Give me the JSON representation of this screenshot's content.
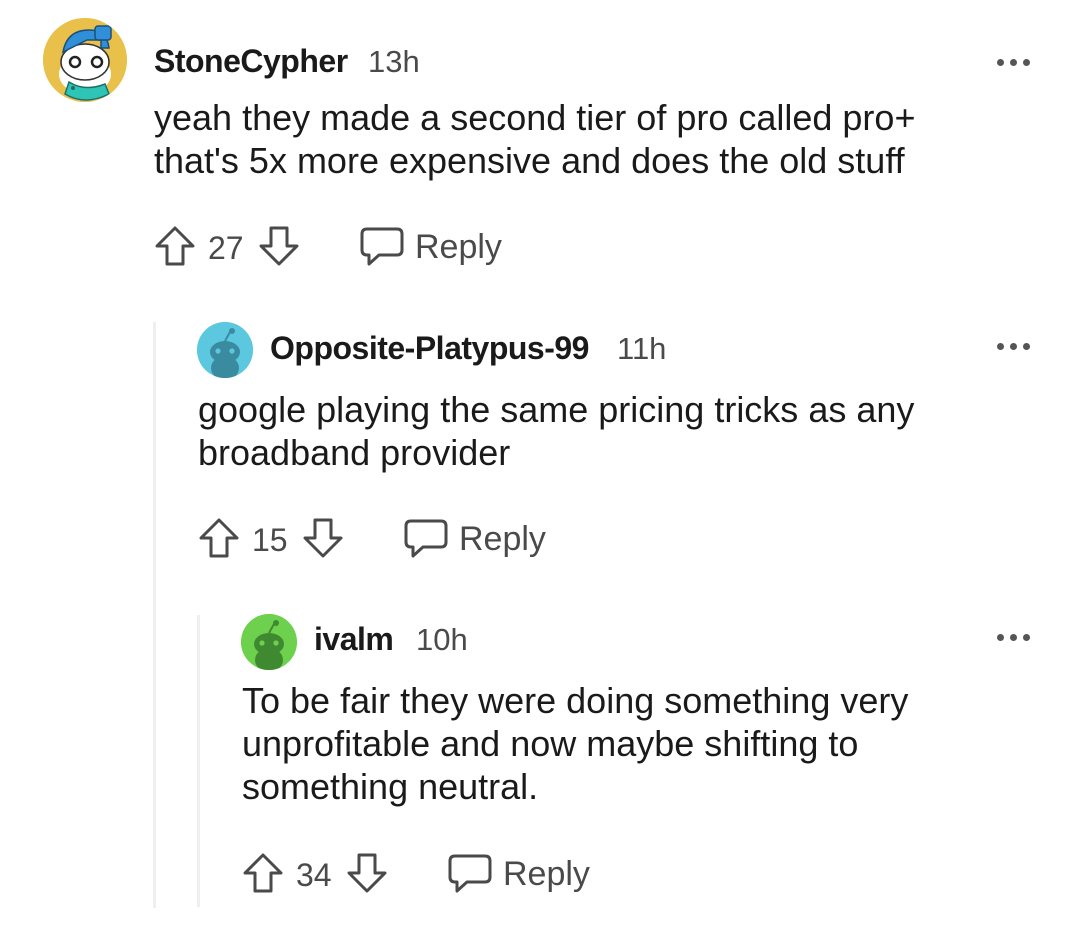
{
  "comments": [
    {
      "username": "StoneCypher",
      "timestamp": "13h",
      "body_lines": [
        "yeah they made a second tier of pro called pro+",
        "that's 5x more expensive and does the old stuff"
      ],
      "votes": "27",
      "reply_label": "Reply",
      "avatar_icon": "snoo-avatar-blue-cap-icon"
    },
    {
      "username": "Opposite-Platypus-99",
      "timestamp": "11h",
      "body_lines": [
        "google playing the same pricing tricks as any",
        "broadband provider"
      ],
      "votes": "15",
      "reply_label": "Reply",
      "avatar_icon": "default-snoo-avatar-cyan-icon"
    },
    {
      "username": "ivalm",
      "timestamp": "10h",
      "body_lines": [
        "To be fair they were doing something very",
        "unprofitable and now maybe shifting to",
        "something neutral."
      ],
      "votes": "34",
      "reply_label": "Reply",
      "avatar_icon": "default-snoo-avatar-green-icon"
    }
  ],
  "colors": {
    "text": "#1a1a1b",
    "meta": "#4a4a4a",
    "thread_line": "#edeff1",
    "avatar_cyan": "#5bc8e0",
    "avatar_green": "#6dd14e",
    "avatar_gold": "#e8c04a"
  }
}
